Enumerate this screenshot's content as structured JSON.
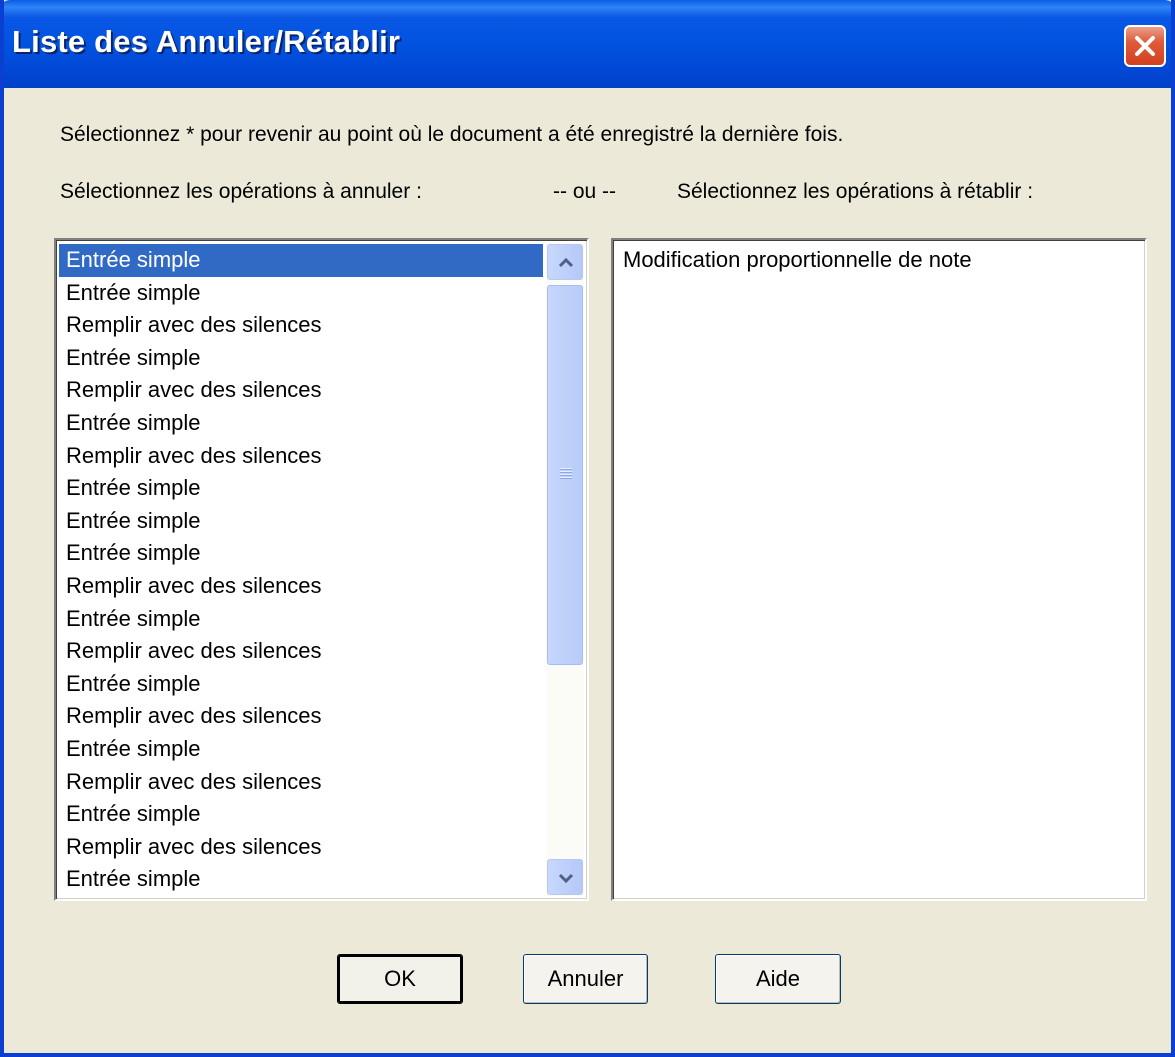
{
  "window": {
    "title": "Liste des Annuler/Rétablir"
  },
  "instructions": {
    "line1": "Sélectionnez * pour revenir au point où le document a été enregistré la dernière fois.",
    "undo_label": "Sélectionnez les opérations à annuler :",
    "separator": "-- ou --",
    "redo_label": "Sélectionnez les opérations à rétablir :"
  },
  "undo_list": {
    "selected_index": 0,
    "items": [
      "Entrée simple",
      "Entrée simple",
      "Remplir avec des silences",
      "Entrée simple",
      "Remplir avec des silences",
      "Entrée simple",
      "Remplir avec des silences",
      "Entrée simple",
      "Entrée simple",
      "Entrée simple",
      "Remplir avec des silences",
      "Entrée simple",
      "Remplir avec des silences",
      "Entrée simple",
      "Remplir avec des silences",
      "Entrée simple",
      "Remplir avec des silences",
      "Entrée simple",
      "Remplir avec des silences",
      "Entrée simple"
    ]
  },
  "redo_list": {
    "items": [
      "Modification proportionnelle de note"
    ]
  },
  "buttons": {
    "ok": "OK",
    "cancel": "Annuler",
    "help": "Aide"
  },
  "icons": {
    "close": "close-icon",
    "scroll_up": "chevron-up-icon",
    "scroll_down": "chevron-down-icon",
    "thumb_grip": "grip-icon"
  },
  "colors": {
    "title_bar": "#0153e0",
    "selection": "#316ac5",
    "dialog_bg": "#ece9d8",
    "close_button": "#e05a3a"
  }
}
